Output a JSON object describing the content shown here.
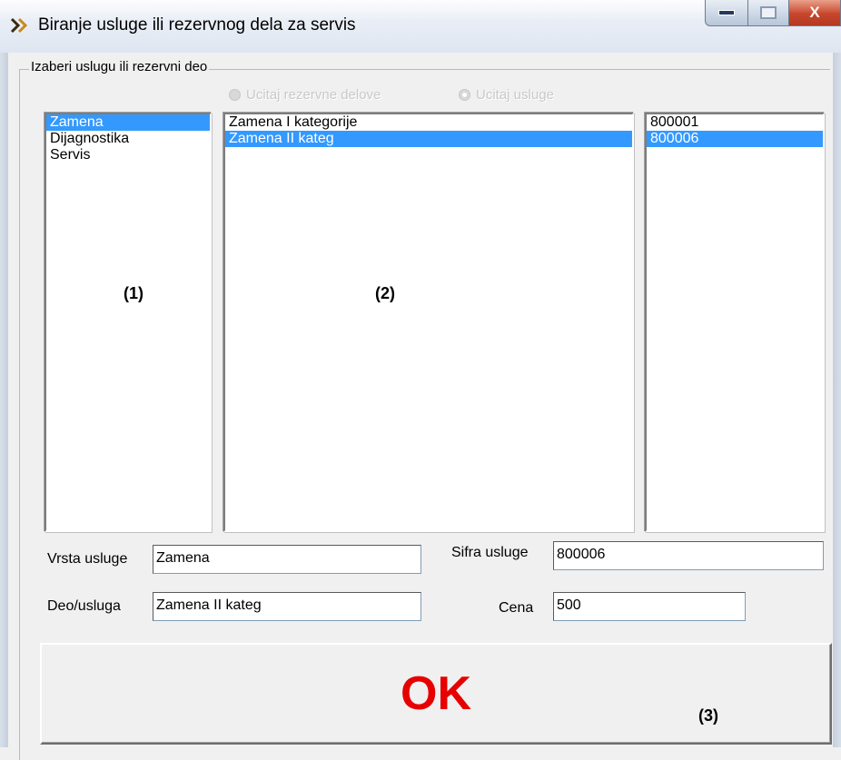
{
  "window": {
    "title": "Biranje usluge ili rezervnog dela za servis",
    "close_glyph": "X"
  },
  "group": {
    "label": "Izaberi uslugu ili rezervni deo"
  },
  "radios": [
    {
      "label": "Ucitaj rezervne delove",
      "checked": false,
      "enabled": false
    },
    {
      "label": "Ucitaj usluge",
      "checked": true,
      "enabled": false
    }
  ],
  "lists": {
    "service_types": {
      "items": [
        "Zamena",
        "Dijagnostika",
        "Servis"
      ],
      "selected": 0,
      "marker": "(1)"
    },
    "services": {
      "items": [
        "Zamena I kategorije",
        "Zamena II kateg"
      ],
      "selected": 1,
      "marker": "(2)"
    },
    "codes": {
      "items": [
        "800001",
        "800006"
      ],
      "selected": 1
    }
  },
  "fields": {
    "vrsta_usluge": {
      "label": "Vrsta usluge",
      "value": "Zamena"
    },
    "deo_usluga": {
      "label": "Deo/usluga",
      "value": "Zamena II kateg"
    },
    "sifra_usluge": {
      "label": "Sifra usluge",
      "value": "800006"
    },
    "cena": {
      "label": "Cena",
      "value": "500"
    }
  },
  "ok_button": {
    "label": "OK",
    "marker": "(3)"
  },
  "colors": {
    "selection": "#3399ff",
    "ok_text": "#e60000"
  }
}
